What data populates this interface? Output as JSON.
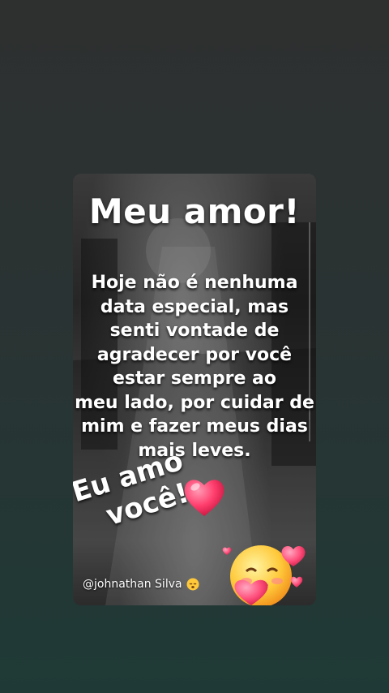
{
  "post": {
    "title": "Meu amor!",
    "message_lines": [
      "Hoje não é nenhuma",
      "data especial, mas",
      "senti vontade de",
      "agradecer por você",
      "estar sempre ao",
      "meu lado, por cuidar de",
      "mim e fazer meus dias",
      "mais leves."
    ],
    "sticker_lines": [
      "Eu amo",
      "você!"
    ],
    "credit": "@johnathan Silva"
  },
  "icons": {
    "big_heart": "heart-icon",
    "hug_face": "smiling-face-with-hearts-icon",
    "credit_emoji": "sleepy-face-icon"
  },
  "colors": {
    "background": "#2b3232",
    "text": "#ffffff",
    "heart": "#ff3f6e"
  }
}
